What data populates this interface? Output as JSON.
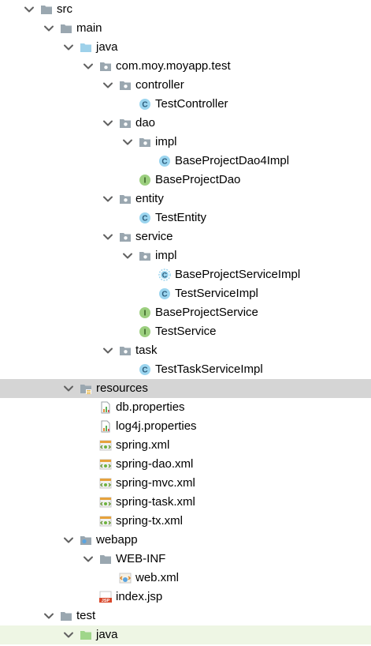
{
  "tree": {
    "nodes": [
      {
        "label": "src",
        "icon": "folder-icon",
        "expanded": true,
        "depth": 0
      },
      {
        "label": "main",
        "icon": "folder-icon",
        "expanded": true,
        "depth": 1
      },
      {
        "label": "java",
        "icon": "source-folder-icon",
        "expanded": true,
        "depth": 2
      },
      {
        "label": "com.moy.moyapp.test",
        "icon": "package-icon",
        "expanded": true,
        "depth": 3
      },
      {
        "label": "controller",
        "icon": "package-icon",
        "expanded": true,
        "depth": 4
      },
      {
        "label": "TestController",
        "icon": "class-icon",
        "expanded": null,
        "depth": 5
      },
      {
        "label": "dao",
        "icon": "package-icon",
        "expanded": true,
        "depth": 4
      },
      {
        "label": "impl",
        "icon": "package-icon",
        "expanded": true,
        "depth": 5
      },
      {
        "label": "BaseProjectDao4Impl",
        "icon": "class-icon",
        "expanded": null,
        "depth": 6
      },
      {
        "label": "BaseProjectDao",
        "icon": "interface-icon",
        "expanded": null,
        "depth": 5
      },
      {
        "label": "entity",
        "icon": "package-icon",
        "expanded": true,
        "depth": 4
      },
      {
        "label": "TestEntity",
        "icon": "class-icon",
        "expanded": null,
        "depth": 5
      },
      {
        "label": "service",
        "icon": "package-icon",
        "expanded": true,
        "depth": 4
      },
      {
        "label": "impl",
        "icon": "package-icon",
        "expanded": true,
        "depth": 5
      },
      {
        "label": "BaseProjectServiceImpl",
        "icon": "abstract-class-icon",
        "expanded": null,
        "depth": 6
      },
      {
        "label": "TestServiceImpl",
        "icon": "class-icon",
        "expanded": null,
        "depth": 6
      },
      {
        "label": "BaseProjectService",
        "icon": "interface-icon",
        "expanded": null,
        "depth": 5
      },
      {
        "label": "TestService",
        "icon": "interface-icon",
        "expanded": null,
        "depth": 5
      },
      {
        "label": "task",
        "icon": "package-icon",
        "expanded": true,
        "depth": 4
      },
      {
        "label": "TestTaskServiceImpl",
        "icon": "class-icon",
        "expanded": null,
        "depth": 5
      },
      {
        "label": "resources",
        "icon": "resources-folder-icon",
        "expanded": true,
        "depth": 2,
        "selected": true
      },
      {
        "label": "db.properties",
        "icon": "properties-file-icon",
        "expanded": null,
        "depth": 3
      },
      {
        "label": "log4j.properties",
        "icon": "properties-file-icon",
        "expanded": null,
        "depth": 3
      },
      {
        "label": "spring.xml",
        "icon": "spring-xml-icon",
        "expanded": null,
        "depth": 3
      },
      {
        "label": "spring-dao.xml",
        "icon": "spring-xml-icon",
        "expanded": null,
        "depth": 3
      },
      {
        "label": "spring-mvc.xml",
        "icon": "spring-xml-icon",
        "expanded": null,
        "depth": 3
      },
      {
        "label": "spring-task.xml",
        "icon": "spring-xml-icon",
        "expanded": null,
        "depth": 3
      },
      {
        "label": "spring-tx.xml",
        "icon": "spring-xml-icon",
        "expanded": null,
        "depth": 3
      },
      {
        "label": "webapp",
        "icon": "web-folder-icon",
        "expanded": true,
        "depth": 2
      },
      {
        "label": "WEB-INF",
        "icon": "folder-icon",
        "expanded": true,
        "depth": 3
      },
      {
        "label": "web.xml",
        "icon": "web-xml-icon",
        "expanded": null,
        "depth": 4
      },
      {
        "label": "index.jsp",
        "icon": "jsp-file-icon",
        "expanded": null,
        "depth": 3
      },
      {
        "label": "test",
        "icon": "folder-icon",
        "expanded": true,
        "depth": 1
      },
      {
        "label": "java",
        "icon": "test-source-folder-icon",
        "expanded": true,
        "depth": 2,
        "current": true
      }
    ]
  },
  "colors": {
    "selected_row": "#d5d5d5",
    "current_row": "#eef6e4",
    "folder_gray": "#9aa7b0",
    "source_folder_blue": "#9ed1ea",
    "test_folder_green": "#9fd68a",
    "class_blue": "#9bd5ef",
    "interface_green": "#9ccf7f",
    "arrow": "#606060"
  }
}
